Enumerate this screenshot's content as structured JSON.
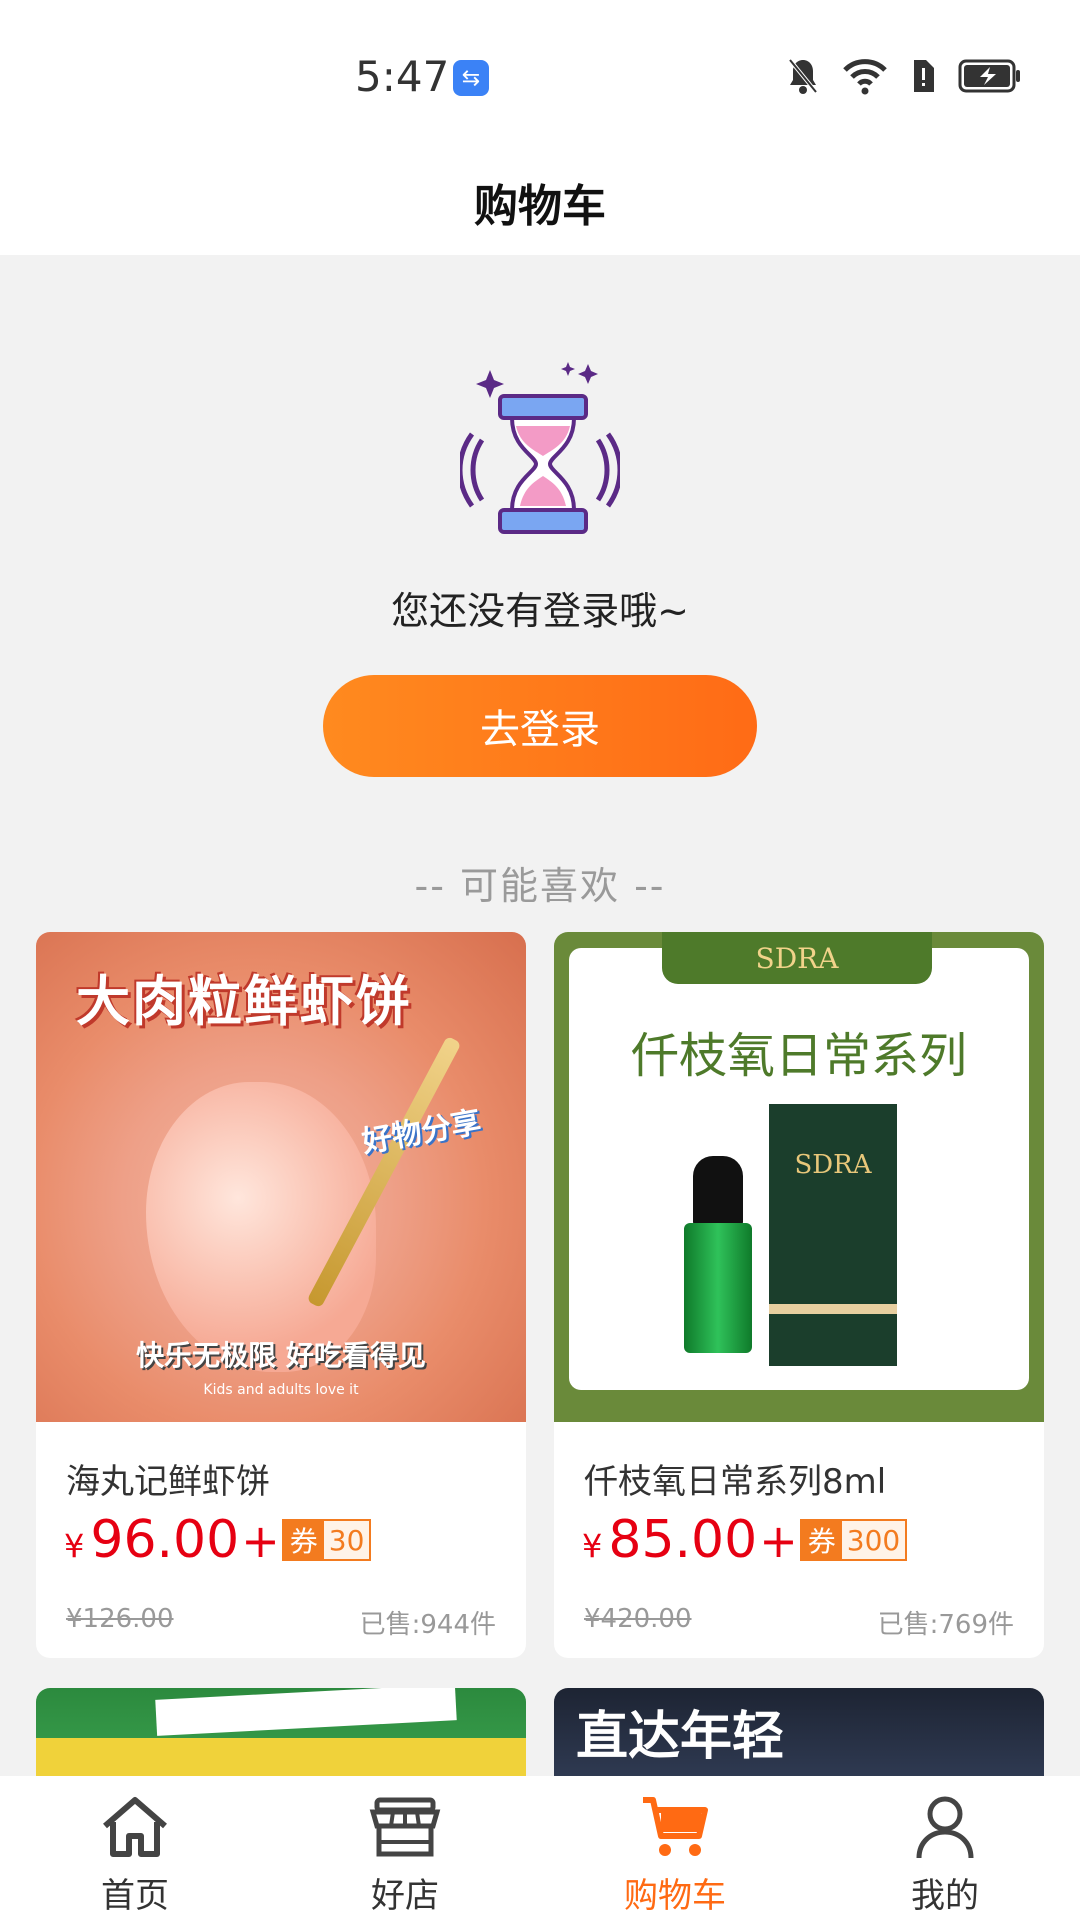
{
  "status_bar": {
    "time": "5:47"
  },
  "header": {
    "title": "购物车"
  },
  "empty_state": {
    "message": "您还没有登录哦~",
    "login_button": "去登录"
  },
  "recommend": {
    "title": "-- 可能喜欢 --"
  },
  "products": [
    {
      "name": "海丸记鲜虾饼",
      "currency": "¥",
      "price": "96.00",
      "plus": "+",
      "coupon_label": "券",
      "coupon_value": "30",
      "original_price": "¥126.00",
      "sold_label": "已售:",
      "sold_count": "944件",
      "image_banner": "大肉粒鲜虾饼",
      "image_sticker": "好物分享",
      "image_bottom": "快乐无极限  好吃看得见",
      "image_bottom_sub": "Kids and adults love it"
    },
    {
      "name": "仟枝氧日常系列8ml",
      "currency": "¥",
      "price": "85.00",
      "plus": "+",
      "coupon_label": "券",
      "coupon_value": "300",
      "original_price": "¥420.00",
      "sold_label": "已售:",
      "sold_count": "769件",
      "image_brand": "SDRA",
      "image_title": "仟枝氧日常系列"
    }
  ],
  "partial_products": [
    {
      "image_text": ""
    },
    {
      "image_text": "直达年轻"
    }
  ],
  "tabbar": {
    "items": [
      {
        "label": "首页",
        "icon": "home-icon"
      },
      {
        "label": "好店",
        "icon": "store-icon"
      },
      {
        "label": "购物车",
        "icon": "cart-icon",
        "active": true
      },
      {
        "label": "我的",
        "icon": "user-icon"
      }
    ],
    "active_color": "#ff6a13"
  },
  "colors": {
    "accent": "#ff6b16",
    "price": "#e60012",
    "coupon": "#f37b1f"
  }
}
